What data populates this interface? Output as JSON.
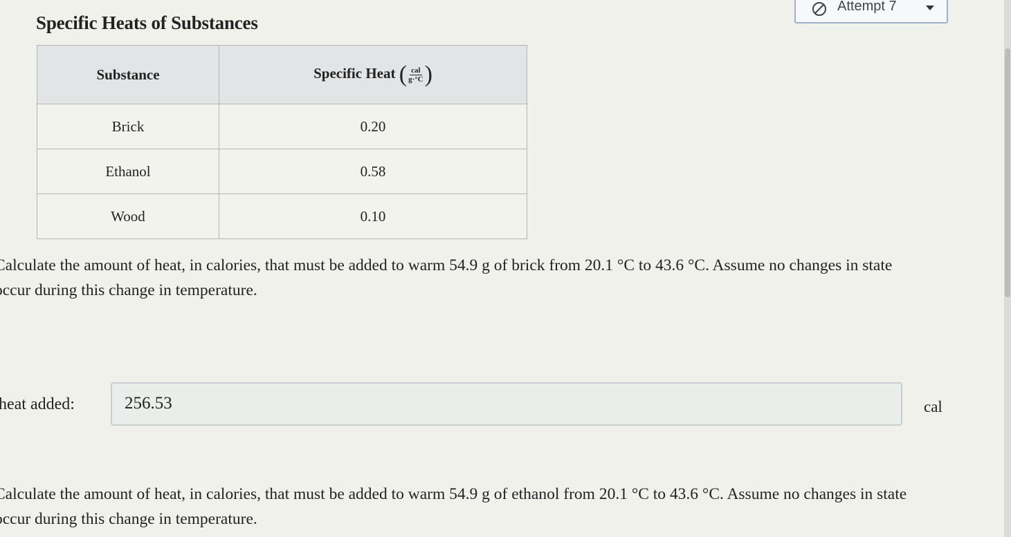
{
  "title": "Specific Heats of Substances",
  "attempt": {
    "label": "Attempt 7"
  },
  "table": {
    "headers": {
      "substance": "Substance",
      "specific_heat": "Specific Heat",
      "unit_numerator": "cal",
      "unit_denominator": "g·°C"
    },
    "rows": [
      {
        "substance": "Brick",
        "value": "0.20"
      },
      {
        "substance": "Ethanol",
        "value": "0.58"
      },
      {
        "substance": "Wood",
        "value": "0.10"
      }
    ]
  },
  "questions": [
    {
      "text": "Calculate the amount of heat, in calories, that must be added to warm 54.9 g of brick from 20.1 °C to 43.6 °C. Assume no changes in state occur during this change in temperature.",
      "answer_label": "heat added:",
      "answer_value": "256.53",
      "unit": "cal"
    },
    {
      "text": "Calculate the amount of heat, in calories, that must be added to warm 54.9 g of ethanol from 20.1 °C to 43.6 °C. Assume no changes in state occur during this change in temperature."
    }
  ]
}
